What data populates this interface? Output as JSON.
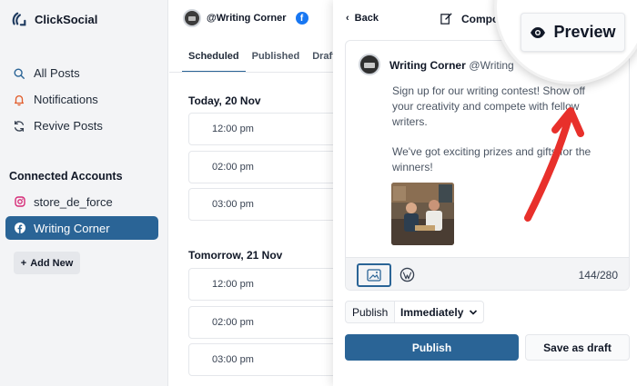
{
  "app": {
    "name": "ClickSocial"
  },
  "sidebar": {
    "nav": [
      {
        "label": "All Posts",
        "icon": "search-icon"
      },
      {
        "label": "Notifications",
        "icon": "bell-icon"
      },
      {
        "label": "Revive Posts",
        "icon": "refresh-icon"
      }
    ],
    "connected_title": "Connected Accounts",
    "accounts": [
      {
        "label": "store_de_force",
        "icon": "instagram-icon"
      },
      {
        "label": "Writing Corner",
        "icon": "facebook-icon",
        "active": true
      }
    ],
    "add_new": "Add New"
  },
  "middle": {
    "account_name": "@Writing Corner",
    "tabs": [
      "Scheduled",
      "Published",
      "Draft"
    ],
    "days": [
      {
        "label": "Today, 20 Nov",
        "slots": [
          "12:00 pm",
          "02:00 pm",
          "03:00 pm"
        ]
      },
      {
        "label": "Tomorrow, 21 Nov",
        "slots": [
          "12:00 pm",
          "02:00 pm",
          "03:00 pm"
        ]
      }
    ]
  },
  "compose": {
    "back": "Back",
    "title": "Compose",
    "preview": "Preview",
    "post": {
      "name": "Writing Corner",
      "handle": "@Writing",
      "paragraph1": "Sign up for our writing contest! Show off your creativity and compete with fellow writers.",
      "paragraph2": "We've got exciting prizes and gifts for the winners!"
    },
    "char_count": "144/280",
    "publish_label": "Publish",
    "publish_when": "Immediately",
    "publish_button": "Publish",
    "draft_button": "Save as draft"
  },
  "colors": {
    "accent": "#2a6496",
    "annotation_arrow": "#e8302b",
    "facebook": "#1877f2",
    "instagram": "#d62976"
  }
}
